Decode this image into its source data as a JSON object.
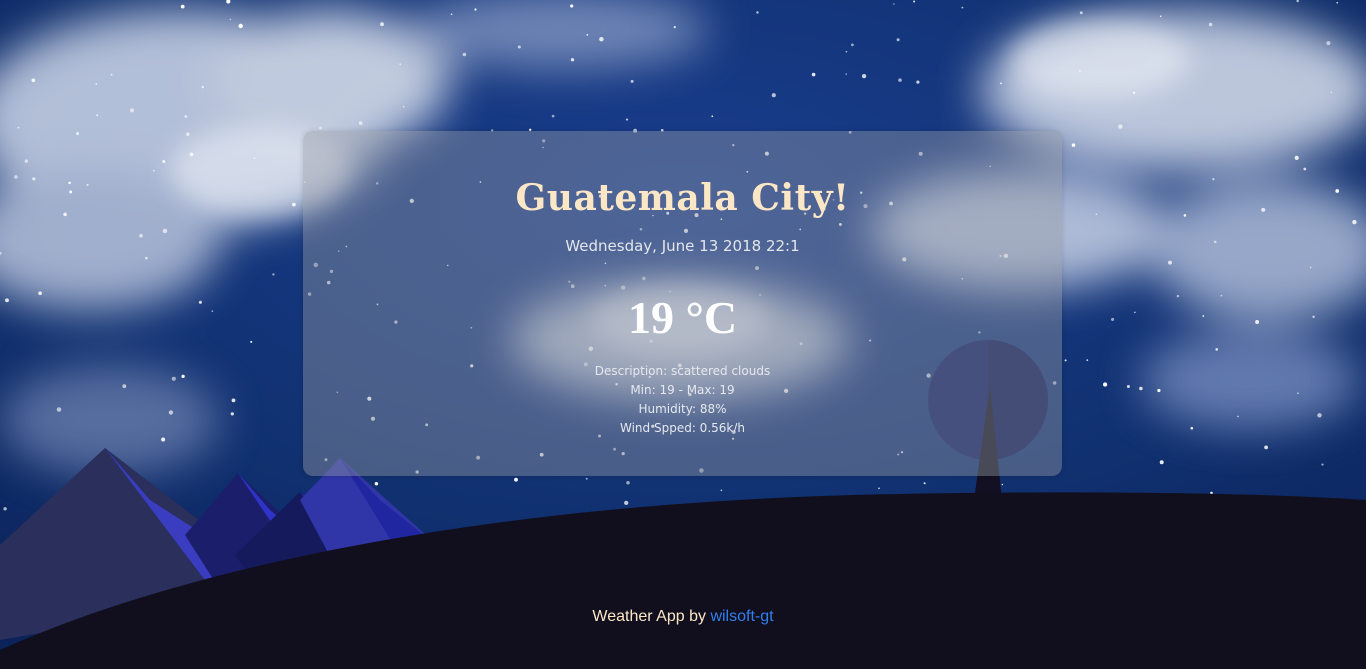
{
  "weather": {
    "city": "Guatemala City!",
    "datetime": "Wednesday, June 13 2018 22:1",
    "temperature": "19 °C",
    "description": "Description: scattered clouds",
    "minmax": "Min: 19 - Max: 19",
    "humidity": "Humidity: 88%",
    "wind": "Wind Spped: 0.56k/h"
  },
  "footer": {
    "text": "Weather App by",
    "author": "wilsoft-gt"
  },
  "colors": {
    "sky": "#0e2a6b",
    "hill": "#110f1d",
    "title": "#fbe7c6",
    "link": "#2f7ff0"
  }
}
